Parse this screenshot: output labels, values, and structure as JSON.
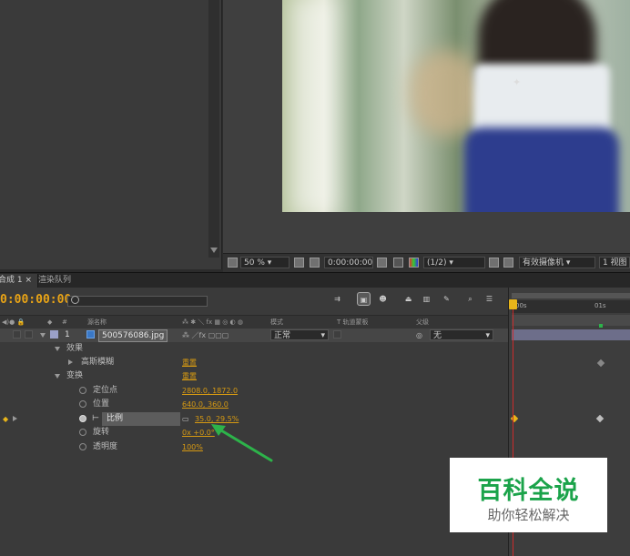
{
  "viewer": {
    "zoom": "50 %",
    "timecode": "0:00:00:00",
    "resolution": "(1/2)",
    "camera": "有效摄像机",
    "view": "1 视图"
  },
  "tabs": {
    "composition": "合成 1",
    "render_queue": "渲染队列"
  },
  "timeline": {
    "current_time": "0:00:00:00",
    "search_placeholder": "",
    "ruler_labels": [
      "00s",
      "01s"
    ],
    "columns": {
      "num": "#",
      "source_name": "源名称",
      "mode": "模式",
      "trkmat": "T  轨道蒙板",
      "parent": "父级"
    },
    "layer": {
      "index": "1",
      "name": "500576086.jpg",
      "mode": "正常",
      "parent": "无"
    },
    "rows": {
      "effects": "效果",
      "gaussian_blur": "高斯模糊",
      "gaussian_blur_value": "重置",
      "transform": "变换",
      "transform_value": "重置",
      "anchor": "定位点",
      "anchor_value": "2808.0, 1872.0",
      "position": "位置",
      "position_value": "640.0, 360.0",
      "scale": "比例",
      "scale_value": "35.0, 29.5%",
      "rotation": "旋转",
      "rotation_value": "0x +0.0°",
      "opacity": "透明度",
      "opacity_value": "100%"
    }
  },
  "watermark": {
    "title": "百科全说",
    "subtitle": "助你轻松解决"
  },
  "colors": {
    "timecode": "#e9a416",
    "property_value": "#d79a12",
    "playhead": "#cc2b2b",
    "watermark_green": "#1ba34a",
    "annotation_arrow": "#2db34a"
  }
}
